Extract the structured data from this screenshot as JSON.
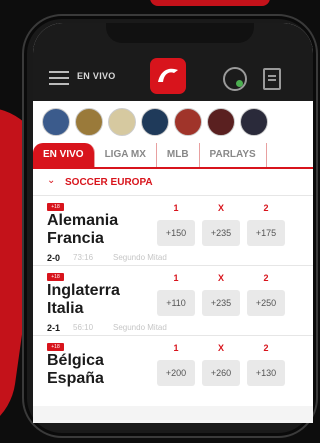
{
  "nav": {
    "label": "EN VIVO"
  },
  "tabs": [
    "EN VIVO",
    "LIGA MX",
    "MLB",
    "PARLAYS"
  ],
  "section": {
    "title": "SOCCER EUROPA"
  },
  "avatar_colors": [
    "#3b5b8c",
    "#9a7a3a",
    "#d6c9a0",
    "#1f3a5a",
    "#a0342a",
    "#5a2020",
    "#2a2a3a"
  ],
  "colors": {
    "accent": "#d8141c",
    "dark": "#1b1b1b"
  },
  "odds_headers": [
    "1",
    "X",
    "2"
  ],
  "matches": [
    {
      "badge": "+18",
      "team1": "Alemania",
      "team2": "Francia",
      "score": "2-0",
      "clock": "73:16",
      "period": "Segundo Mitad",
      "odds": [
        "+150",
        "+235",
        "+175"
      ]
    },
    {
      "badge": "+18",
      "team1": "Inglaterra",
      "team2": "Italia",
      "score": "2-1",
      "clock": "56:10",
      "period": "Segundo Mitad",
      "odds": [
        "+110",
        "+235",
        "+250"
      ]
    },
    {
      "badge": "+18",
      "team1": "Bélgica",
      "team2": "España",
      "score": "",
      "clock": "",
      "period": "",
      "odds": [
        "+200",
        "+260",
        "+130"
      ]
    }
  ]
}
